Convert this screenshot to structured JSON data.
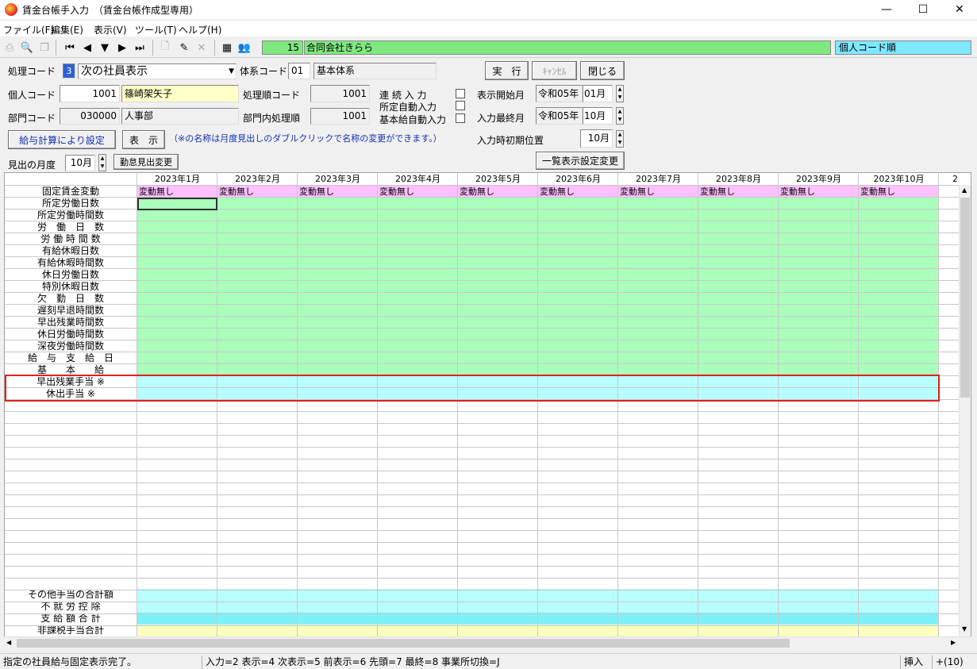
{
  "window": {
    "title": "賃金台帳手入力　（賃金台帳作成型専用）",
    "minimize": "—",
    "maximize": "☐",
    "close": "✕"
  },
  "menu": [
    "ファイル(F)",
    "編集(E)",
    "表示(V)",
    "ツール(T)",
    "ヘルプ(H)"
  ],
  "toolbar": {
    "employee_no": "15",
    "company_name": "合同会社きらら",
    "sort_order": "個人コード順"
  },
  "form": {
    "process_code_label": "処理コード",
    "process_code_value": "3",
    "process_mode": "次の社員表示",
    "system_code_label": "体系コード",
    "system_code": "01",
    "system_name": "基本体系",
    "run_button": "実　行",
    "cancel_button": "ｷｬﾝｾﾙ",
    "close_button": "閉じる",
    "person_code_label": "個人コード",
    "person_code": "1001",
    "person_name": "篠崎架矢子",
    "proc_order_code_label": "処理順コード",
    "proc_order_code": "1001",
    "continuous_input_label": "連 続 入 力",
    "auto_scheduled_label": "所定自動入力",
    "auto_base_pay_label": "基本給自動入力",
    "display_start_label": "表示開始月",
    "display_start_era": "令和05",
    "year_suffix": "年",
    "display_start_month": "01月",
    "dept_code_label": "部門コード",
    "dept_code": "030000",
    "dept_name": "人事部",
    "dept_proc_order_label": "部門内処理順",
    "dept_proc_order": "1001",
    "input_last_label": "入力最終月",
    "input_last_era": "令和05",
    "input_last_month": "10月",
    "calc_button": "給与計算により設定",
    "show_button": "表　示",
    "note": "（※の名称は月度見出しのダブルクリックで名称の変更ができます。）",
    "initial_pos_label": "入力時初期位置",
    "initial_pos_month": "10月",
    "heading_month_label": "見出の月度",
    "heading_month": "10月",
    "attendance_heading_button": "勤怠見出変更",
    "list_settings_button": "一覧表示設定変更"
  },
  "grid": {
    "months": [
      "2023年1月",
      "2023年2月",
      "2023年3月",
      "2023年4月",
      "2023年5月",
      "2023年6月",
      "2023年7月",
      "2023年8月",
      "2023年9月",
      "2023年10月"
    ],
    "next_col_fragment": "2",
    "fixed_wage_label": "固定賃金変動",
    "fixed_wage_value": "変動無し",
    "rows": [
      "所定労働日数",
      "所定労働時間数",
      "労　働　日　数",
      "労 働 時 間 数",
      "有給休暇日数",
      "有給休暇時間数",
      "休日労働日数",
      "特別休暇日数",
      "欠　勤　日　数",
      "遅刻早退時間数",
      "早出残業時間数",
      "休日労働時間数",
      "深夜労働時間数",
      "給　与　支　給　日",
      "基　　本　　給",
      "早出残業手当 ※",
      "休出手当 ※"
    ],
    "bottom_rows": [
      "その他手当の合計額",
      "不 就 労 控 除",
      "支 給 額 合 計",
      "非課税手当合計"
    ],
    "colors": {
      "green": "#aaffbb",
      "cyan": "#b8ffff",
      "cyan2": "#80f0f8",
      "yellow": "#ffffc0",
      "pink": "#ffc0ff",
      "highlight": "#e02020"
    }
  },
  "status": {
    "message": "指定の社員給与固定表示完了。",
    "keys": "入力=2 表示=4 次表示=5 前表示=6 先頭=7 最終=8 事業所切換=J",
    "mode": "挿入",
    "extra": "+(10)"
  }
}
